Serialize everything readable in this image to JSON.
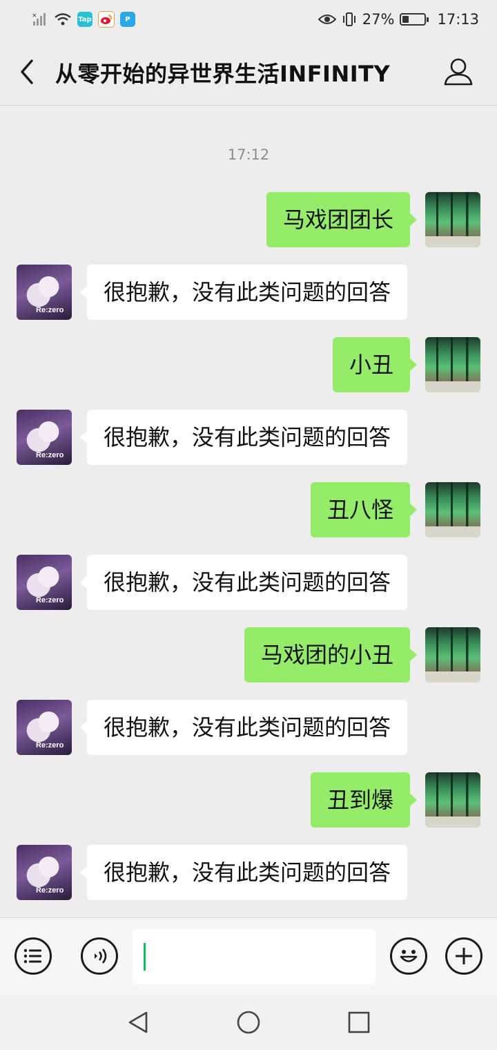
{
  "status_bar": {
    "battery_percent": "27%",
    "battery_level": 0.27,
    "time": "17:13",
    "notification_icons": [
      "tap-icon",
      "weibo-icon",
      "p-icon"
    ]
  },
  "header": {
    "title": "从零开始的异世界生活INFINITY"
  },
  "chat": {
    "timestamp": "17:12",
    "messages": [
      {
        "from": "self",
        "text": "马戏团团长"
      },
      {
        "from": "bot",
        "text": "很抱歉，没有此类问题的回答"
      },
      {
        "from": "self",
        "text": "小丑"
      },
      {
        "from": "bot",
        "text": "很抱歉，没有此类问题的回答"
      },
      {
        "from": "self",
        "text": "丑八怪"
      },
      {
        "from": "bot",
        "text": "很抱歉，没有此类问题的回答"
      },
      {
        "from": "self",
        "text": "马戏团的小丑"
      },
      {
        "from": "bot",
        "text": "很抱歉，没有此类问题的回答"
      },
      {
        "from": "self",
        "text": "丑到爆"
      },
      {
        "from": "bot",
        "text": "很抱歉，没有此类问题的回答"
      }
    ],
    "bot_avatar_logo": "Re:zero"
  },
  "input_bar": {
    "value": "",
    "buttons": [
      "menu-icon",
      "voice-icon",
      "emoji-icon",
      "plus-icon"
    ]
  },
  "colors": {
    "outgoing_bubble": "#95ec69",
    "incoming_bubble": "#ffffff",
    "background": "#ededed",
    "cursor": "#07c160"
  }
}
